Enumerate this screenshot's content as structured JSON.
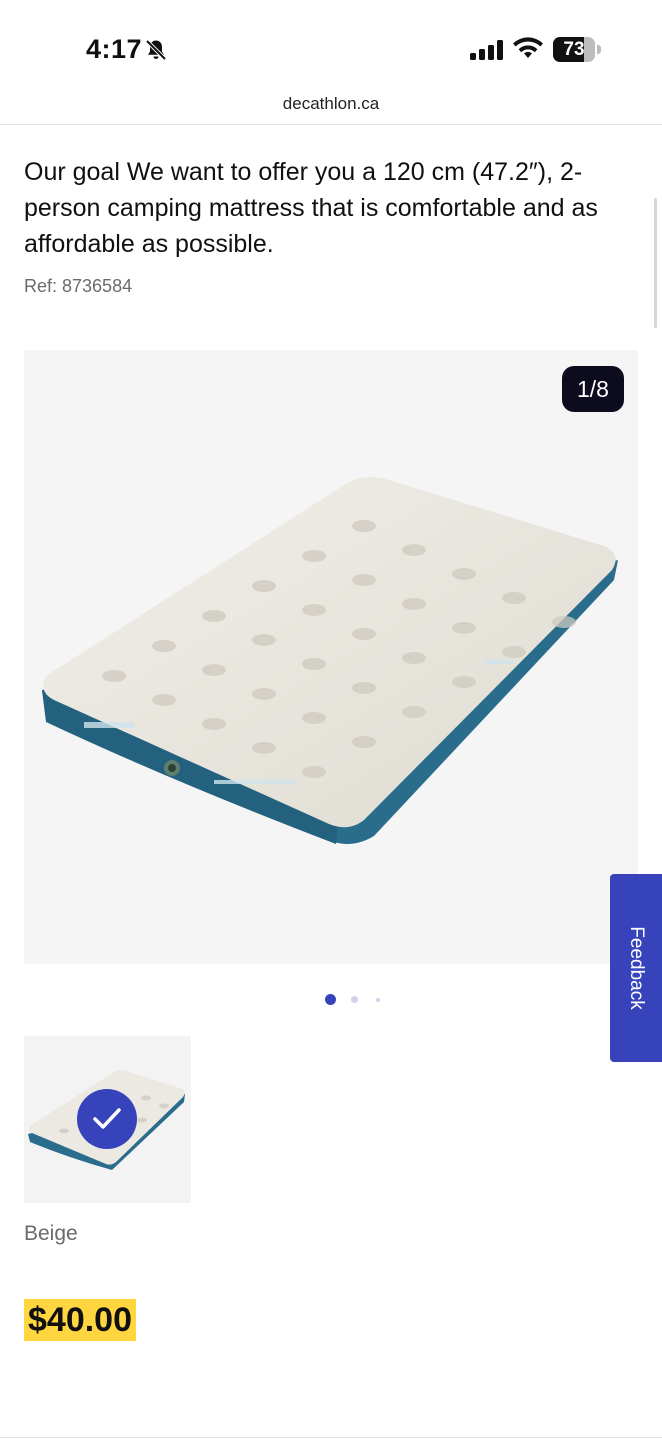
{
  "status_bar": {
    "time": "4:17",
    "battery_percent": 73,
    "battery_label": "73"
  },
  "browser": {
    "url": "decathlon.ca"
  },
  "product": {
    "description": "Our goal We want to offer you a 120 cm (47.2″), 2-person camping mattress that is comfortable and as affordable as possible.",
    "ref": "Ref: 8736584",
    "gallery_counter": "1/8",
    "color_label": "Beige",
    "price": "$40.00"
  },
  "feedback": {
    "label": "Feedback"
  },
  "icons": {
    "bell": "bell-muted-icon",
    "signal": "cellular-signal-icon",
    "wifi": "wifi-icon",
    "battery": "battery-icon",
    "check": "checkmark-icon"
  },
  "colors": {
    "accent": "#3643ba",
    "price_highlight": "#ffd63f",
    "counter_bg": "#0c0c1e"
  }
}
